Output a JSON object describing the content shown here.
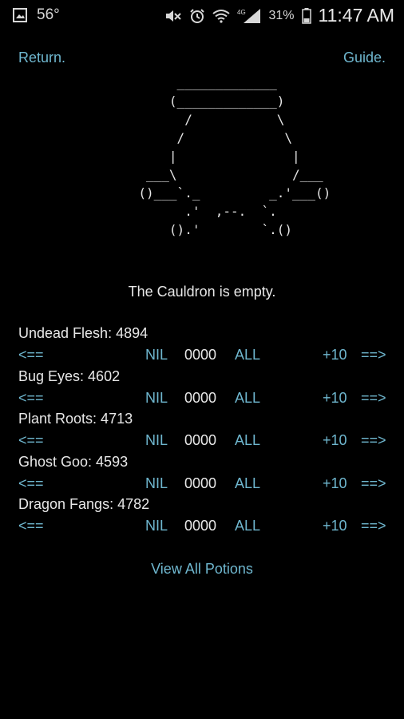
{
  "status_bar": {
    "temperature": "56°",
    "network": "4G",
    "battery": "31%",
    "time": "11:47 AM"
  },
  "nav": {
    "return_label": "Return.",
    "guide_label": "Guide."
  },
  "cauldron": {
    "art": "                       _____________\n                      (_____________)\n                        /           \\\n                       /             \\\n                      |               |\n                   ___\\               /___\n                  ()___`._         _.'___()\n                        .'  ,--.  `.\n                      ().'        `.()",
    "status": "The Cauldron is empty."
  },
  "ingredients": [
    {
      "name": "Undead Flesh",
      "count": "4894",
      "label": "Undead Flesh: 4894"
    },
    {
      "name": "Bug Eyes",
      "count": "4602",
      "label": "Bug Eyes: 4602"
    },
    {
      "name": "Plant Roots",
      "count": "4713",
      "label": "Plant Roots: 4713"
    },
    {
      "name": "Ghost Goo",
      "count": "4593",
      "label": "Ghost Goo: 4593"
    },
    {
      "name": "Dragon Fangs",
      "count": "4782",
      "label": "Dragon Fangs: 4782"
    }
  ],
  "controls": {
    "prev": "<==",
    "nil": "NIL",
    "amount": "0000",
    "all": "ALL",
    "plus": "+10",
    "next": "==>"
  },
  "footer": {
    "view_all_label": "View All Potions"
  },
  "colors": {
    "background": "#000000",
    "link": "#6fb7cf",
    "text": "#e8e8e8"
  }
}
